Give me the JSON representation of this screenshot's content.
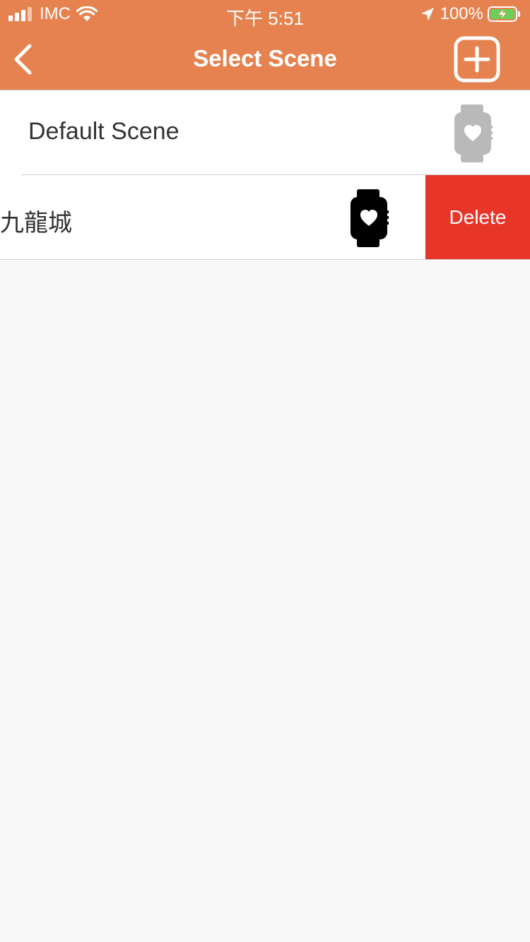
{
  "status_bar": {
    "carrier": "IMC",
    "time": "下午 5:51",
    "battery": "100%"
  },
  "nav": {
    "title": "Select Scene",
    "back_icon": "chevron-left-icon",
    "add_icon": "plus-square-icon"
  },
  "scenes": [
    {
      "label": "Default Scene",
      "icon": "watch-heart-icon",
      "icon_color": "#b9b9b9"
    },
    {
      "label": "九龍城",
      "icon": "watch-heart-icon",
      "icon_color": "#000000",
      "action": "Delete"
    }
  ],
  "colors": {
    "accent": "#e6824f",
    "delete": "#e8352a",
    "background": "#f8f8f8"
  }
}
